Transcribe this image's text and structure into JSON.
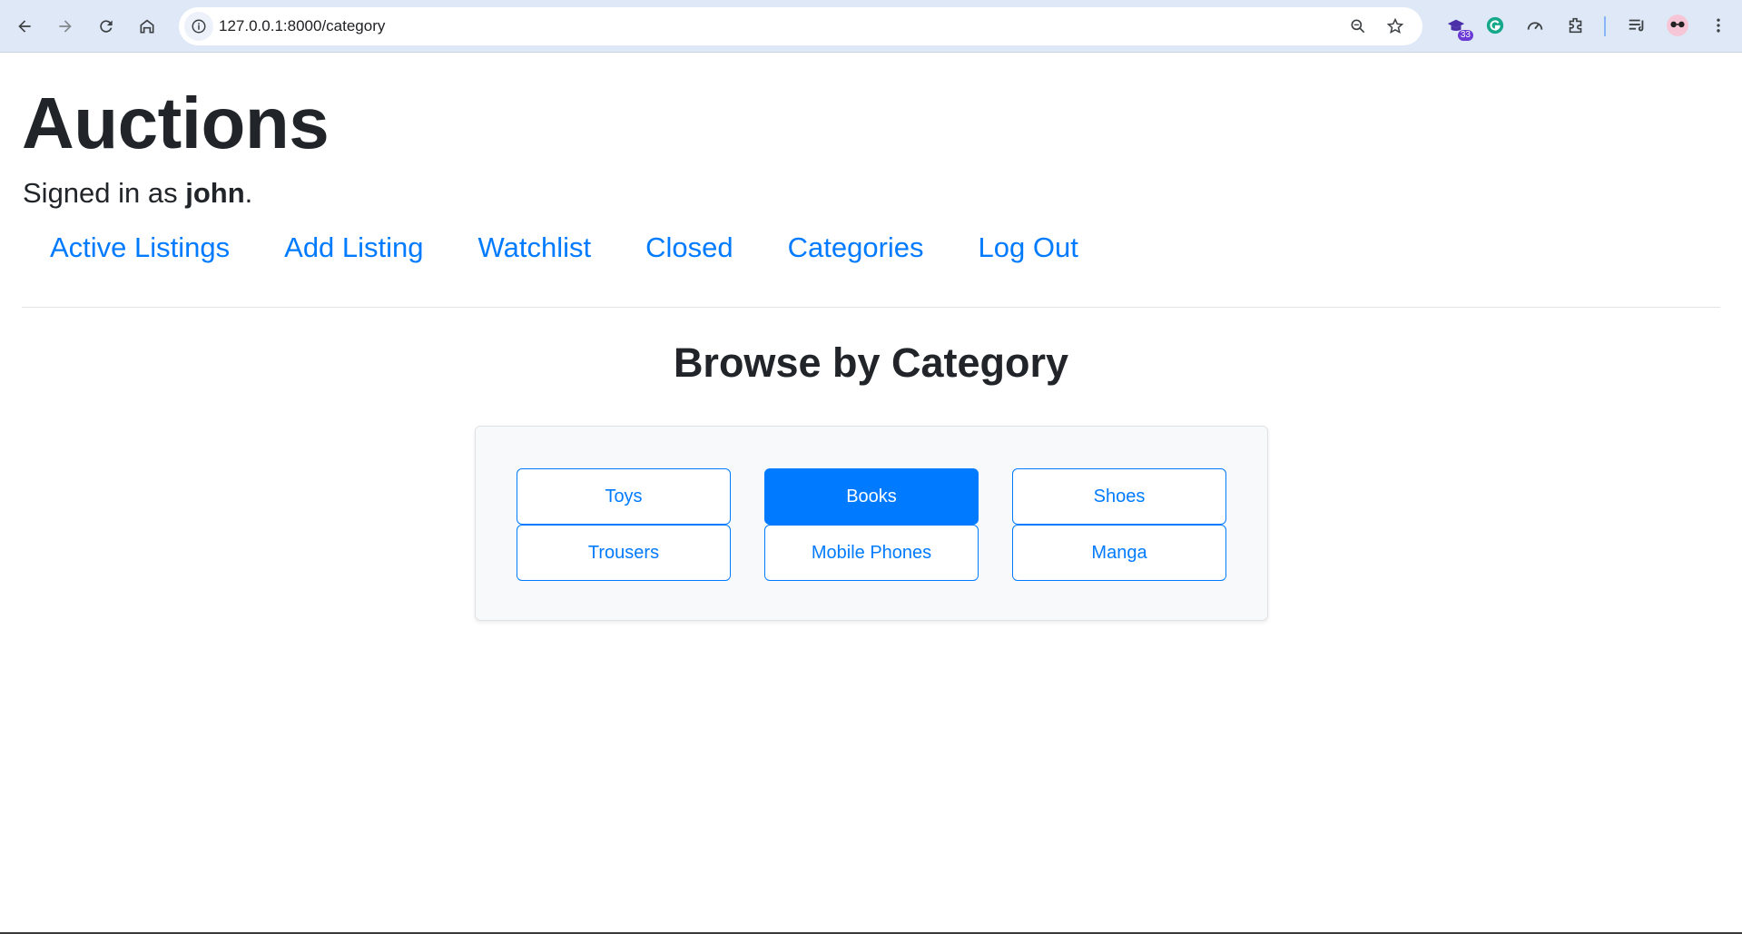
{
  "browser": {
    "url": "127.0.0.1:8000/category",
    "extension_badge": "33",
    "colors": {
      "toolbar": "#dfe8f7",
      "omnibox": "#ffffff"
    }
  },
  "header": {
    "title": "Auctions",
    "signed_in_prefix": "Signed in as ",
    "username": "john",
    "signed_in_suffix": "."
  },
  "nav": {
    "items": [
      {
        "label": "Active Listings"
      },
      {
        "label": "Add Listing"
      },
      {
        "label": "Watchlist"
      },
      {
        "label": "Closed"
      },
      {
        "label": "Categories"
      },
      {
        "label": "Log Out"
      }
    ]
  },
  "main": {
    "heading": "Browse by Category",
    "categories": [
      {
        "label": "Toys",
        "selected": false
      },
      {
        "label": "Books",
        "selected": true
      },
      {
        "label": "Shoes",
        "selected": false
      },
      {
        "label": "Trousers",
        "selected": false
      },
      {
        "label": "Mobile Phones",
        "selected": false
      },
      {
        "label": "Manga",
        "selected": false
      }
    ]
  },
  "colors": {
    "link": "#007bff",
    "primary": "#007bff",
    "text": "#212529",
    "card_bg": "#f8f9fa"
  }
}
